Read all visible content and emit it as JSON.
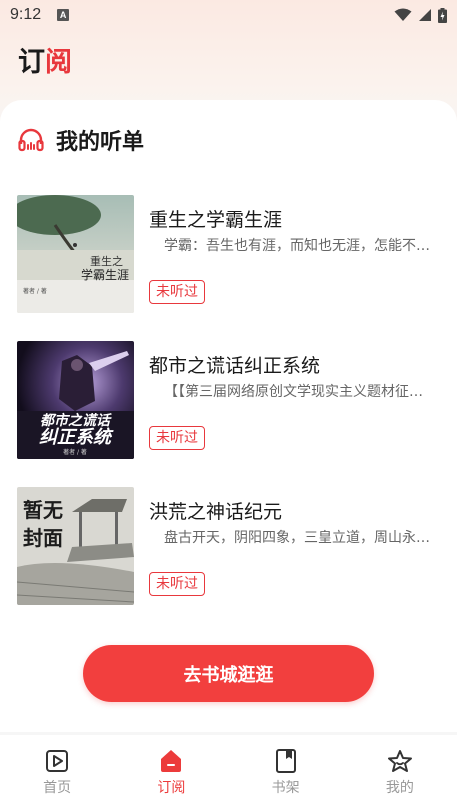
{
  "status_bar": {
    "time": "9:12",
    "notification_glyph": "A"
  },
  "header": {
    "title_part1": "订",
    "title_part2": "阅"
  },
  "section": {
    "title": "我的听单",
    "icon": "headphones-icon"
  },
  "books": [
    {
      "title": "重生之学霸生涯",
      "description": "学霸：吾生也有涯，而知也无涯，怎能不…",
      "badge": "未听过",
      "cover_text_1": "重生之",
      "cover_text_2": "学霸生涯",
      "cover_author": "著者 / 著"
    },
    {
      "title": "都市之谎话纠正系统",
      "description": "【【第三届网络原创文学现实主义题材征…",
      "badge": "未听过",
      "cover_text_1": "都市之谎话",
      "cover_text_2": "纠正系统",
      "cover_author": "著者 / 著"
    },
    {
      "title": "洪荒之神话纪元",
      "description": "盘古开天，阴阳四象，三皇立道，周山永…",
      "badge": "未听过",
      "cover_text_1": "暂无",
      "cover_text_2": "封面"
    }
  ],
  "cta": {
    "label": "去书城逛逛"
  },
  "tabbar": [
    {
      "label": "首页",
      "icon": "home-play-icon"
    },
    {
      "label": "订阅",
      "icon": "subscribe-icon",
      "active": true
    },
    {
      "label": "书架",
      "icon": "bookshelf-icon"
    },
    {
      "label": "我的",
      "icon": "profile-star-icon"
    }
  ],
  "colors": {
    "accent": "#f23f3e",
    "inactive": "#999999",
    "page_bg": "#f6f6f6"
  }
}
